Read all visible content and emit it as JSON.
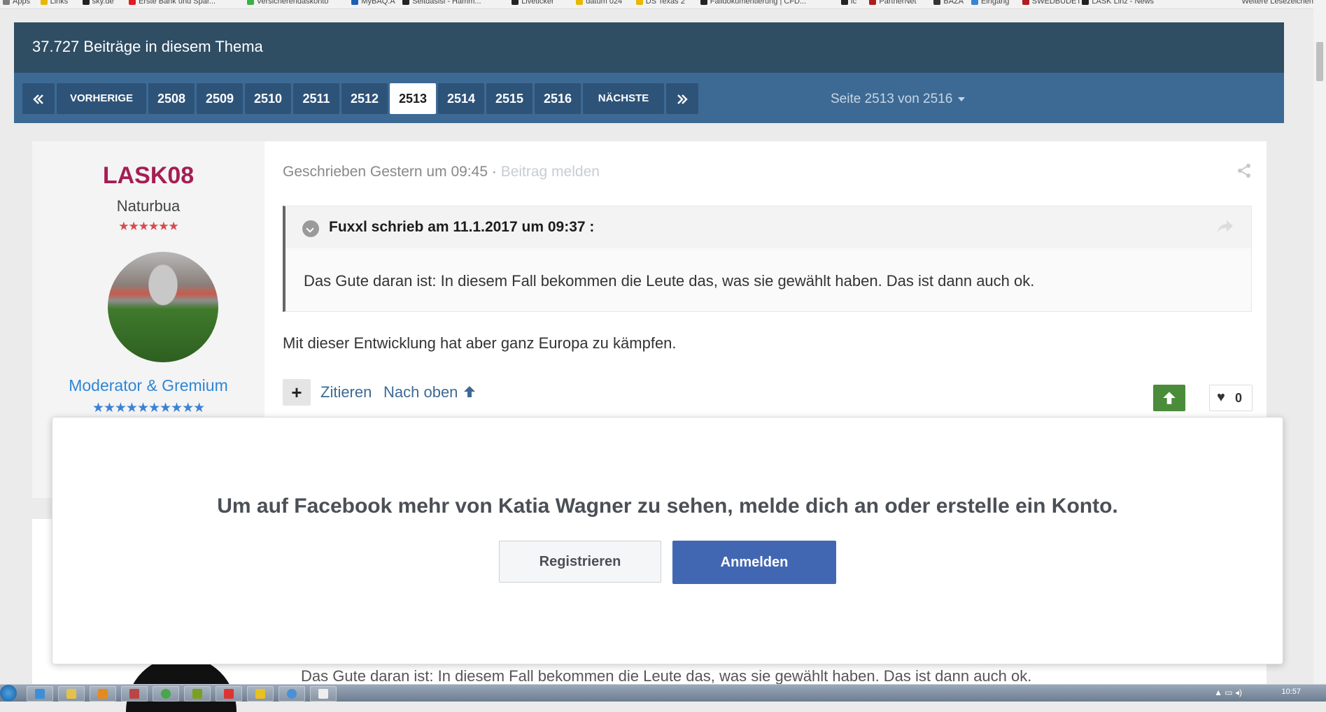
{
  "bookmarks": {
    "items": [
      {
        "label": "Apps",
        "color": "#7d7d7d"
      },
      {
        "label": "Links",
        "color": "#e6b800"
      },
      {
        "label": "sky.de",
        "color": "#222222"
      },
      {
        "label": "Erste Bank und Spar...",
        "color": "#e11d1d"
      },
      {
        "label": "Versicherendaskonto",
        "color": "#3cb043"
      },
      {
        "label": "MyBAQ.A",
        "color": "#1a5fb4"
      },
      {
        "label": "Seitdasisi - Hamm...",
        "color": "#222222"
      },
      {
        "label": "Liveticker",
        "color": "#222222"
      },
      {
        "label": "datum 024",
        "color": "#e6b800"
      },
      {
        "label": "DS Texas 2",
        "color": "#e6b800"
      },
      {
        "label": "Falldokumentierung | CFD...",
        "color": "#222222"
      },
      {
        "label": "Ic",
        "color": "#222222"
      },
      {
        "label": "PartnerNet",
        "color": "#b01c1c"
      },
      {
        "label": "BAZA",
        "color": "#333333"
      },
      {
        "label": "Eingang",
        "color": "#3b82d6"
      },
      {
        "label": "SWEDBUDET",
        "color": "#b01c1c"
      },
      {
        "label": "LASK Linz - News",
        "color": "#222222"
      }
    ],
    "more": "Weitere Lesezeichen"
  },
  "topic": {
    "post_count_title": "37.727 Beiträge in diesem Thema"
  },
  "pagination": {
    "first_icon": "double-chevron-left-icon",
    "prev_label": "VORHERIGE",
    "pages": [
      "2508",
      "2509",
      "2510",
      "2511",
      "2512",
      "2513",
      "2514",
      "2515",
      "2516"
    ],
    "current_page": "2513",
    "next_label": "NÄCHSTE",
    "last_icon": "double-chevron-right-icon",
    "page_jump": "Seite 2513 von 2516"
  },
  "post": {
    "author": {
      "name": "LASK08",
      "title": "Naturbua",
      "rank_stars": "★★★★★★",
      "group": "Moderator & Gremium",
      "group_stars": "★★★★★★★★★★"
    },
    "meta": {
      "posted": "Geschrieben Gestern um 09:45",
      "separator": "·",
      "report": "Beitrag melden"
    },
    "quote": {
      "citation": "Fuxxl schrieb am 11.1.2017 um 09:37 :",
      "text": "Das Gute daran ist: In diesem Fall bekommen die Leute das, was sie gewählt haben. Das ist dann auch ok."
    },
    "text": "Mit dieser Entwicklung hat aber ganz Europa zu kämpfen.",
    "actions": {
      "plus": "+",
      "quote": "Zitieren",
      "top": "Nach oben",
      "like_count": "0"
    }
  },
  "next_post_partial": {
    "text": "Das Gute daran ist: In diesem Fall bekommen die Leute das, was sie gewählt haben. Das ist dann auch ok."
  },
  "facebook_modal": {
    "message": "Um auf Facebook mehr von Katia Wagner zu sehen, melde dich an oder erstelle ein Konto.",
    "register": "Registrieren",
    "login": "Anmelden"
  },
  "taskbar": {
    "clock": "10:57"
  },
  "colors": {
    "header_bg": "#2f4d63",
    "pagination_bg": "#3d6a94",
    "author_name": "#a41e54",
    "group_name": "#2f86d6",
    "upvote": "#4a8c3a",
    "facebook_blue": "#4267b2"
  }
}
